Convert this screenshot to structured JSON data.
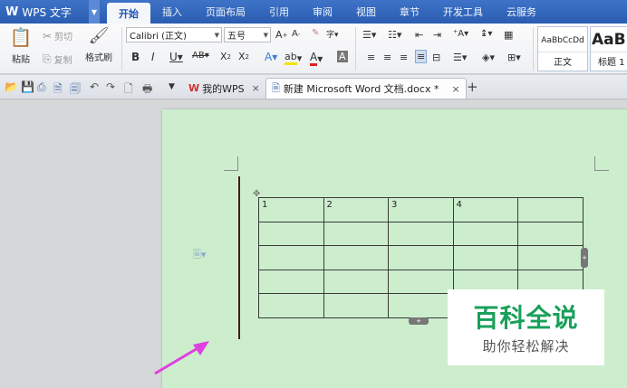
{
  "app": {
    "name": "WPS 文字"
  },
  "menu": {
    "tabs": [
      "开始",
      "插入",
      "页面布局",
      "引用",
      "审阅",
      "视图",
      "章节",
      "开发工具",
      "云服务"
    ],
    "active_index": 0
  },
  "ribbon": {
    "cut": "剪切",
    "copy": "复制",
    "paste": "粘贴",
    "format_painter": "格式刷",
    "font_name": "Calibri (正文)",
    "font_size": "五号",
    "styles": [
      {
        "sample": "AaBbCcDd",
        "name": "正文"
      },
      {
        "sample": "AaB",
        "name": "标题 1"
      }
    ]
  },
  "doc_tabs": [
    {
      "label": "我的WPS",
      "active": false
    },
    {
      "label": "新建 Microsoft Word 文档.docx *",
      "active": true
    }
  ],
  "table": {
    "header": [
      "1",
      "2",
      "3",
      "4",
      ""
    ],
    "empty_rows": 4
  },
  "watermark": {
    "title": "百科全说",
    "subtitle": "助你轻松解决"
  },
  "colors": {
    "accent": "#2a5db1",
    "page_bg": "#cceecd",
    "arrow": "#e040e0",
    "watermark_green": "#19a05a"
  }
}
